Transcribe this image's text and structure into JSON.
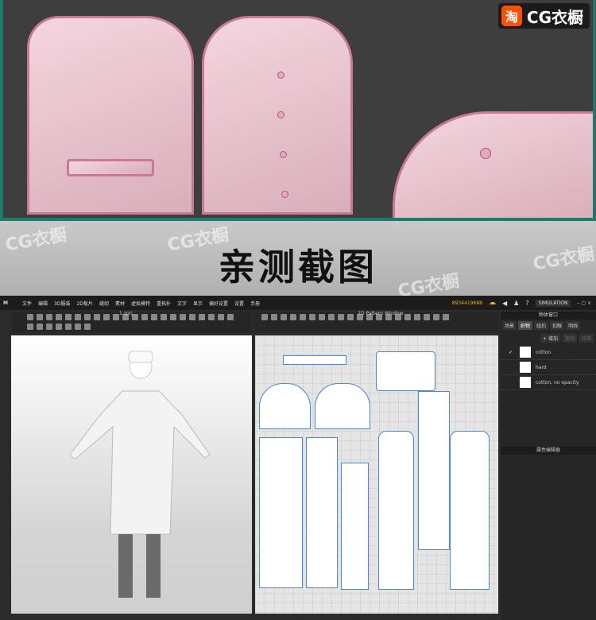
{
  "logo": {
    "icon": "淘",
    "text": "CG衣橱"
  },
  "banner": {
    "headline": "亲测截图",
    "watermark": "CG衣橱"
  },
  "app": {
    "menu": [
      "文件",
      "编辑",
      "3D服装",
      "2D板片",
      "缝纫",
      "素材",
      "虚拟模特",
      "重拓扑",
      "文字",
      "显示",
      "偏好设置",
      "设置",
      "手册"
    ],
    "user_id": "8934419688",
    "mode": "SIMULATION",
    "viewport3d_title": "1.zprj",
    "viewport2d_title": "2D Pattern Window",
    "object_panel": {
      "title": "物体窗口",
      "tabs": [
        "场景",
        "织物",
        "纽扣",
        "扣眼",
        "明线"
      ],
      "active_tab": 1,
      "buttons": [
        "+ 增加",
        "复制",
        "应用"
      ],
      "fabrics": [
        {
          "name": "cotton",
          "checked": true
        },
        {
          "name": "hard",
          "checked": false
        },
        {
          "name": "cotton, no opacity",
          "checked": false
        }
      ]
    },
    "property_editor_title": "属性编辑器",
    "colors": {
      "accent": "#f0b400",
      "pattern_outline": "#4a87d6"
    }
  }
}
